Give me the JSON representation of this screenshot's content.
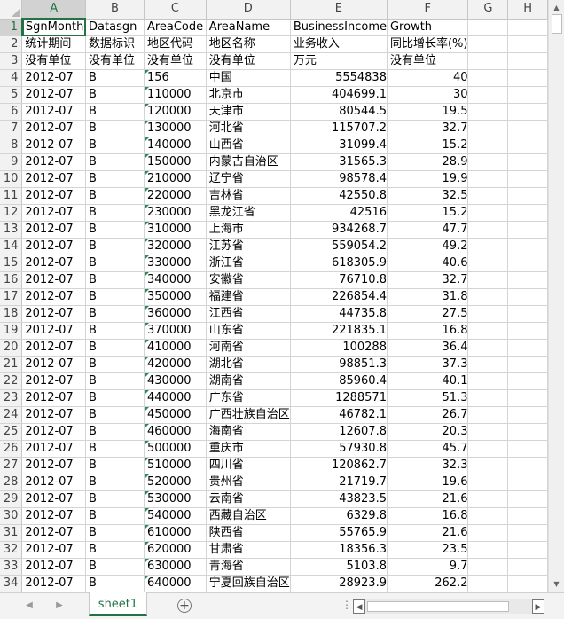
{
  "columns": [
    "A",
    "B",
    "C",
    "D",
    "E",
    "F",
    "G",
    "H"
  ],
  "active_cell": "A1",
  "rows": [
    [
      "SgnMonth",
      "Datasgn",
      "AreaCode",
      "AreaName",
      "BusinessIncome",
      "Growth",
      "",
      ""
    ],
    [
      "统计期间",
      "数据标识",
      "地区代码",
      "地区名称",
      "业务收入",
      "同比增长率(%)",
      "",
      ""
    ],
    [
      "没有单位",
      "没有单位",
      "没有单位",
      "没有单位",
      "万元",
      "没有单位",
      "",
      ""
    ],
    [
      "2012-07",
      "B",
      "156",
      "中国",
      "5554838",
      "40",
      "",
      ""
    ],
    [
      "2012-07",
      "B",
      "110000",
      "北京市",
      "404699.1",
      "30",
      "",
      ""
    ],
    [
      "2012-07",
      "B",
      "120000",
      "天津市",
      "80544.5",
      "19.5",
      "",
      ""
    ],
    [
      "2012-07",
      "B",
      "130000",
      "河北省",
      "115707.2",
      "32.7",
      "",
      ""
    ],
    [
      "2012-07",
      "B",
      "140000",
      "山西省",
      "31099.4",
      "15.2",
      "",
      ""
    ],
    [
      "2012-07",
      "B",
      "150000",
      "内蒙古自治区",
      "31565.3",
      "28.9",
      "",
      ""
    ],
    [
      "2012-07",
      "B",
      "210000",
      "辽宁省",
      "98578.4",
      "19.9",
      "",
      ""
    ],
    [
      "2012-07",
      "B",
      "220000",
      "吉林省",
      "42550.8",
      "32.5",
      "",
      ""
    ],
    [
      "2012-07",
      "B",
      "230000",
      "黑龙江省",
      "42516",
      "15.2",
      "",
      ""
    ],
    [
      "2012-07",
      "B",
      "310000",
      "上海市",
      "934268.7",
      "47.7",
      "",
      ""
    ],
    [
      "2012-07",
      "B",
      "320000",
      "江苏省",
      "559054.2",
      "49.2",
      "",
      ""
    ],
    [
      "2012-07",
      "B",
      "330000",
      "浙江省",
      "618305.9",
      "40.6",
      "",
      ""
    ],
    [
      "2012-07",
      "B",
      "340000",
      "安徽省",
      "76710.8",
      "32.7",
      "",
      ""
    ],
    [
      "2012-07",
      "B",
      "350000",
      "福建省",
      "226854.4",
      "31.8",
      "",
      ""
    ],
    [
      "2012-07",
      "B",
      "360000",
      "江西省",
      "44735.8",
      "27.5",
      "",
      ""
    ],
    [
      "2012-07",
      "B",
      "370000",
      "山东省",
      "221835.1",
      "16.8",
      "",
      ""
    ],
    [
      "2012-07",
      "B",
      "410000",
      "河南省",
      "100288",
      "36.4",
      "",
      ""
    ],
    [
      "2012-07",
      "B",
      "420000",
      "湖北省",
      "98851.3",
      "37.3",
      "",
      ""
    ],
    [
      "2012-07",
      "B",
      "430000",
      "湖南省",
      "85960.4",
      "40.1",
      "",
      ""
    ],
    [
      "2012-07",
      "B",
      "440000",
      "广东省",
      "1288571",
      "51.3",
      "",
      ""
    ],
    [
      "2012-07",
      "B",
      "450000",
      "广西壮族自治区",
      "46782.1",
      "26.7",
      "",
      ""
    ],
    [
      "2012-07",
      "B",
      "460000",
      "海南省",
      "12607.8",
      "20.3",
      "",
      ""
    ],
    [
      "2012-07",
      "B",
      "500000",
      "重庆市",
      "57930.8",
      "45.7",
      "",
      ""
    ],
    [
      "2012-07",
      "B",
      "510000",
      "四川省",
      "120862.7",
      "32.3",
      "",
      ""
    ],
    [
      "2012-07",
      "B",
      "520000",
      "贵州省",
      "21719.7",
      "19.6",
      "",
      ""
    ],
    [
      "2012-07",
      "B",
      "530000",
      "云南省",
      "43823.5",
      "21.6",
      "",
      ""
    ],
    [
      "2012-07",
      "B",
      "540000",
      "西藏自治区",
      "6329.8",
      "16.8",
      "",
      ""
    ],
    [
      "2012-07",
      "B",
      "610000",
      "陕西省",
      "55765.9",
      "21.6",
      "",
      ""
    ],
    [
      "2012-07",
      "B",
      "620000",
      "甘肃省",
      "18356.3",
      "23.5",
      "",
      ""
    ],
    [
      "2012-07",
      "B",
      "630000",
      "青海省",
      "5103.8",
      "9.7",
      "",
      ""
    ],
    [
      "2012-07",
      "B",
      "640000",
      "宁夏回族自治区",
      "28923.9",
      "262.2",
      "",
      ""
    ]
  ],
  "sheet_tabs": [
    "sheet1"
  ],
  "icons": {
    "scroll_up": "▲",
    "scroll_down": "▼",
    "tab_prev": "◀",
    "tab_next": "▶",
    "add_sheet": "+",
    "more": "⋮",
    "hscroll_left": "◀",
    "hscroll_right": "▶"
  },
  "colors": {
    "accent": "#217346",
    "header_bg": "#f2f2f2",
    "gridline": "#d4d4d4",
    "text_marker": "#2e8b57"
  }
}
